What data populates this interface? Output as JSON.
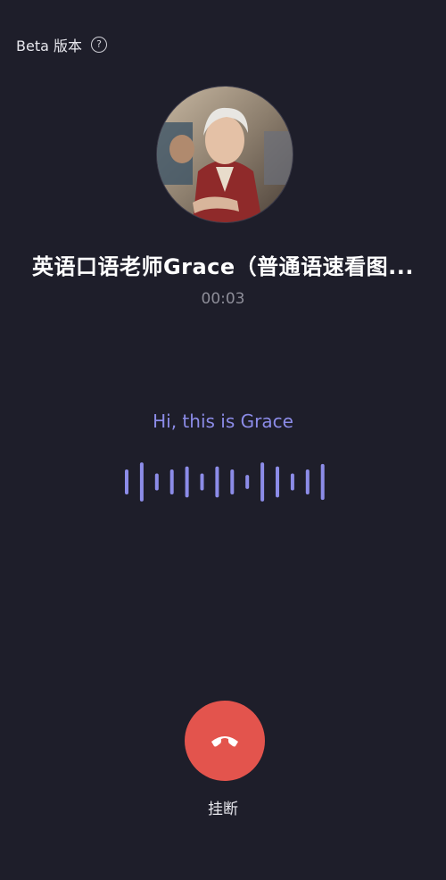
{
  "header": {
    "beta_label": "Beta 版本",
    "help_icon": "question-circle-icon"
  },
  "contact": {
    "name": "英语口语老师Grace（普通语速看图...",
    "avatar_icon": "portrait-avatar"
  },
  "call": {
    "duration": "00:03"
  },
  "transcript": {
    "text": "Hi, this is Grace"
  },
  "waveform": {
    "color": "#8c8ce8",
    "levels": [
      0.5,
      0.78,
      0.34,
      0.5,
      0.62,
      0.34,
      0.62,
      0.5,
      0.28,
      0.78,
      0.62,
      0.34,
      0.5,
      0.72
    ]
  },
  "controls": {
    "hangup_label": "挂断",
    "hangup_color": "#e3544d",
    "hangup_icon": "phone-hangup-icon"
  }
}
